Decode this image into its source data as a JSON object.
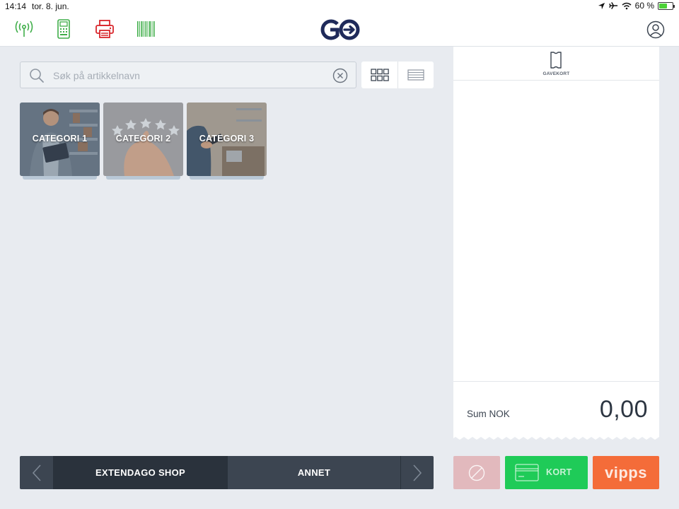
{
  "status_bar": {
    "time": "14:14",
    "date": "tor. 8. jun.",
    "battery": "60 %",
    "battery_level": 0.6,
    "icons": [
      "location-icon",
      "airplane-icon",
      "wifi-icon",
      "battery-icon"
    ]
  },
  "toolbar": {
    "icons": [
      "wireless-signal-icon",
      "payment-terminal-icon",
      "printer-icon",
      "barcode-scanner-icon"
    ],
    "colors": {
      "terminal_ok": "#3fae49",
      "printer_error": "#d9262c"
    },
    "logo_text": "GO",
    "logo_color": "#1f2a5a",
    "profile_icon": "user-profile-icon"
  },
  "search": {
    "placeholder": "Søk på artikkelnavn",
    "value": ""
  },
  "view_modes": [
    "grid-view-icon",
    "list-view-icon"
  ],
  "categories": [
    {
      "label": "CATEGORI 1"
    },
    {
      "label": "CATEGORI 2"
    },
    {
      "label": "CATEGORI 3"
    }
  ],
  "bottom_nav": {
    "tabs": [
      {
        "label": "EXTENDAGO SHOP",
        "active": true
      },
      {
        "label": "ANNET",
        "active": false
      }
    ]
  },
  "receipt": {
    "giftcard_label": "GAVEKORT",
    "sum_label": "Sum NOK",
    "sum_value": "0,00"
  },
  "payment": {
    "card_label": "KORT",
    "vipps_label": "vipps",
    "colors": {
      "void": "#e2b9bd",
      "card": "#1fcb58",
      "vipps": "#f46c39"
    }
  }
}
